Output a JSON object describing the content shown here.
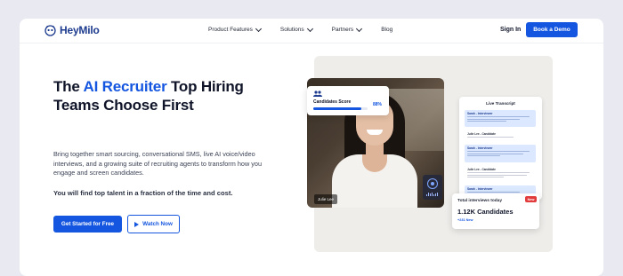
{
  "brand": {
    "name": "HeyMilo",
    "accent": "#1456e0"
  },
  "nav": {
    "links": [
      {
        "label": "Product Features",
        "has_dropdown": true
      },
      {
        "label": "Solutions",
        "has_dropdown": true
      },
      {
        "label": "Partners",
        "has_dropdown": true
      },
      {
        "label": "Blog",
        "has_dropdown": false
      }
    ],
    "signin": "Sign In",
    "cta": "Book a Demo"
  },
  "hero": {
    "title_pre": "The ",
    "title_accent": "AI Recruiter",
    "title_post": " Top Hiring Teams Choose First",
    "description": "Bring together smart sourcing, conversational SMS, live AI voice/video interviews, and a growing suite of recruiting agents to transform how you engage and screen candidates.",
    "bold_line": "You will find top talent in a fraction of the time and cost.",
    "primary_cta": "Get Started for Free",
    "secondary_cta": "Watch Now"
  },
  "visual": {
    "candidates_score": {
      "label": "Candidates Score",
      "percent_text": "88%",
      "percent": 88
    },
    "video": {
      "name_tag": "Julie Lee"
    },
    "transcript": {
      "title": "Live Transcript",
      "messages": [
        {
          "who": "Sarah - Interviewer",
          "style": "blue"
        },
        {
          "who": "Julie Lee - Candidate",
          "style": "white"
        },
        {
          "who": "Sarah - Interviewer",
          "style": "blue"
        },
        {
          "who": "Julie Lee - Candidate",
          "style": "white"
        },
        {
          "who": "Sarah - Interviewer",
          "style": "blue"
        }
      ]
    },
    "total_interviews": {
      "label": "Total interviews today",
      "badge": "New",
      "value": "1.12K Candidates",
      "sub": "+231 New"
    }
  }
}
